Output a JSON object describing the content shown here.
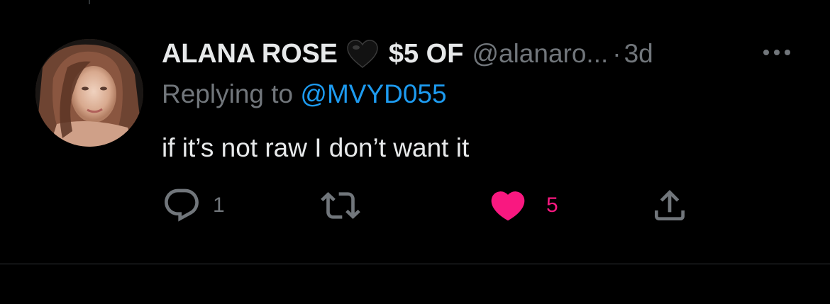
{
  "tweet": {
    "display_name": "ALANA ROSE",
    "name_suffix": "$5 OF",
    "handle": "@alanaro...",
    "separator": "·",
    "time": "3d",
    "replying_prefix": "Replying to ",
    "replying_to": "@MVYD055",
    "text": "if it’s not raw I don’t want it",
    "reply_count": "1",
    "like_count": "5"
  },
  "icons": {
    "avatar": "profile-photo",
    "name_emoji": "black-heart-icon",
    "more": "more-dots-icon",
    "reply": "reply-bubble-icon",
    "retweet": "retweet-icon",
    "like": "heart-filled-icon",
    "share": "share-icon"
  },
  "colors": {
    "background": "#000000",
    "text_primary": "#e7e9ea",
    "text_secondary": "#71767b",
    "link": "#1d9bf0",
    "like": "#f91880",
    "divider": "#2f3336"
  }
}
